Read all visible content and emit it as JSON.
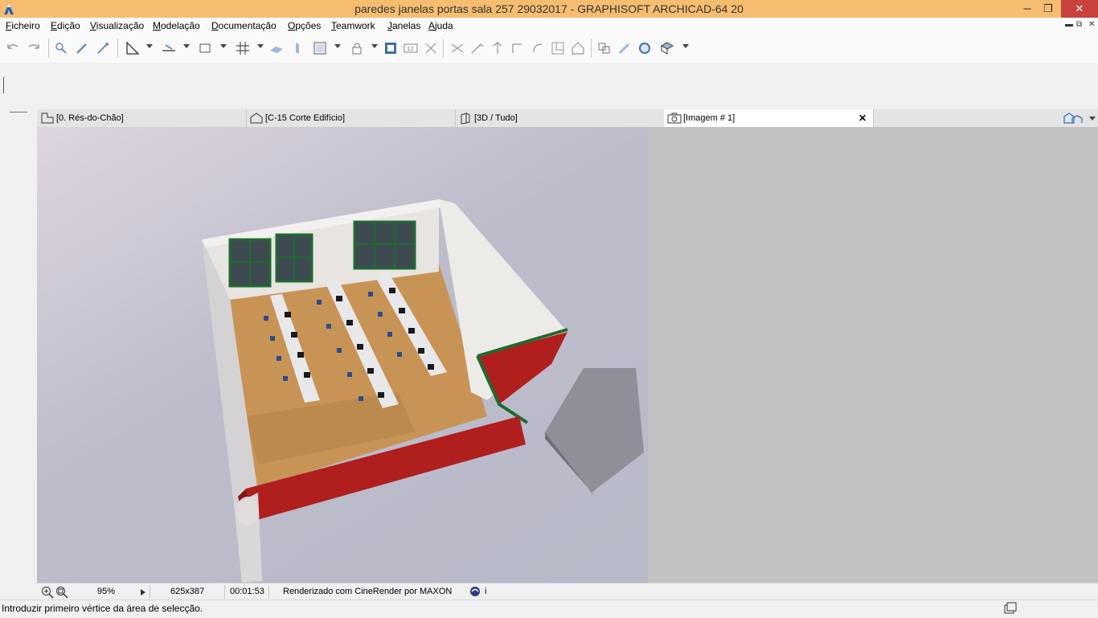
{
  "window": {
    "title": "paredes janelas portas sala 257 29032017 - GRAPHISOFT ARCHICAD-64 20",
    "minimize": "─",
    "maximize": "❐",
    "close": "✕",
    "title_bar_color": "#f6bd71"
  },
  "menu": [
    "Ficheiro",
    "Edição",
    "Visualização",
    "Modelação",
    "Documentação",
    "Opções",
    "Teamwork",
    "Janelas",
    "Ajuda"
  ],
  "doc_controls": {
    "minimize": "▬",
    "restore": "⧉",
    "close": "✕"
  },
  "toolbar_icons": [
    "undo-icon",
    "redo-icon",
    "find-select-icon",
    "eyedropper-icon",
    "syringe-icon",
    "ruler-icon",
    "guide-line-icon",
    "dimension-icon",
    "grid-snap-icon",
    "plane-icon",
    "edit-plane-icon",
    "view-icon",
    "lock-icon",
    "layers-icon",
    "measure-icon",
    "magic-wand-icon",
    "split-icon",
    "adjust-icon",
    "elevation-icon",
    "offset-icon",
    "rotate-icon",
    "resize-icon",
    "roof-icon",
    "group-icon",
    "brush-icon",
    "render-icon",
    "3d-style-icon"
  ],
  "tabs": [
    {
      "label": "[0. Rés-do-Chão]",
      "icon": "floor-plan-icon"
    },
    {
      "label": "[C-15 Corte Edifício]",
      "icon": "section-icon"
    },
    {
      "label": "[3D / Tudo]",
      "icon": "3d-view-icon"
    },
    {
      "label": "[Imagem # 1]",
      "icon": "camera-icon",
      "active": true,
      "close": "✕"
    }
  ],
  "status_strip": {
    "zoom": "95%",
    "resolution": "625x387",
    "time": "00:01:53",
    "engine": "Renderizado com CineRender por MAXON",
    "info": "i"
  },
  "prompt": "Introduzir primeiro vértice da área de selecção.",
  "colors": {
    "accent_red": "#b01e1e",
    "window_frame_green": "#1f6b2e",
    "floor_wood": "#c89456",
    "background_gray": "#c2c2c2"
  }
}
